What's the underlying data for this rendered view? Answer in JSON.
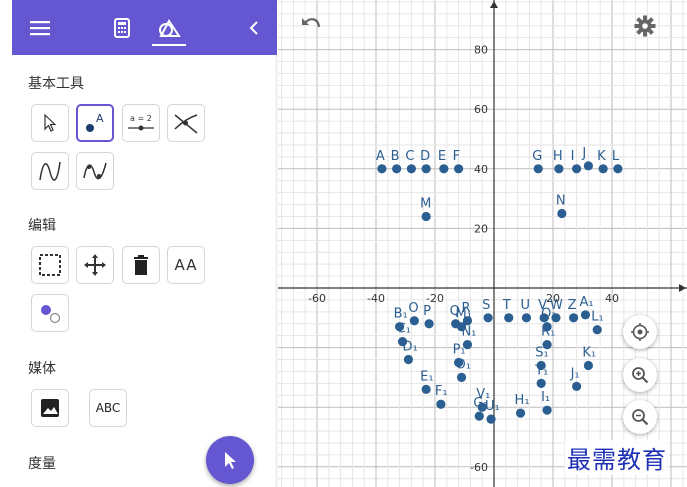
{
  "sections": {
    "basic_tools": "基本工具",
    "edit": "编辑",
    "media": "媒体",
    "measure": "度量"
  },
  "tools": {
    "slider_label": "a = 2",
    "text_tool_label": "AA",
    "text_button_label": "ABC"
  },
  "colors": {
    "accent": "#6557d2",
    "point": "#2c5f91",
    "watermark": "#1c2fb5"
  },
  "graph": {
    "x_range": [
      -70,
      70
    ],
    "y_range": [
      -65,
      95
    ],
    "x_ticks": [
      -60,
      -40,
      -20,
      20,
      40
    ],
    "y_ticks": [
      80,
      60,
      40,
      20,
      -60
    ],
    "grid": true,
    "points": [
      {
        "label": "A",
        "x": -38,
        "y": 40
      },
      {
        "label": "B",
        "x": -33,
        "y": 40
      },
      {
        "label": "C",
        "x": -28,
        "y": 40
      },
      {
        "label": "D",
        "x": -23,
        "y": 40
      },
      {
        "label": "E",
        "x": -17,
        "y": 40
      },
      {
        "label": "F",
        "x": -12,
        "y": 40
      },
      {
        "label": "G",
        "x": 15,
        "y": 40
      },
      {
        "label": "H",
        "x": 22,
        "y": 40
      },
      {
        "label": "I",
        "x": 28,
        "y": 40
      },
      {
        "label": "J",
        "x": 32,
        "y": 41
      },
      {
        "label": "K",
        "x": 37,
        "y": 40
      },
      {
        "label": "L",
        "x": 42,
        "y": 40
      },
      {
        "label": "M",
        "x": -23,
        "y": 24
      },
      {
        "label": "N",
        "x": 23,
        "y": 25
      },
      {
        "label": "O",
        "x": -27,
        "y": -11
      },
      {
        "label": "P",
        "x": -22,
        "y": -12
      },
      {
        "label": "Q",
        "x": -13,
        "y": -12
      },
      {
        "label": "R",
        "x": -9,
        "y": -11
      },
      {
        "label": "S",
        "x": -2,
        "y": -10
      },
      {
        "label": "T",
        "x": 5,
        "y": -10
      },
      {
        "label": "U",
        "x": 11,
        "y": -10
      },
      {
        "label": "V",
        "x": 17,
        "y": -10
      },
      {
        "label": "W",
        "x": 21,
        "y": -10
      },
      {
        "label": "Z",
        "x": 27,
        "y": -10
      },
      {
        "label": "A₁",
        "x": 31,
        "y": -9
      },
      {
        "label": "B₁",
        "x": -32,
        "y": -13
      },
      {
        "label": "C₁",
        "x": -31,
        "y": -18
      },
      {
        "label": "D₁",
        "x": -29,
        "y": -24
      },
      {
        "label": "E₁",
        "x": -23,
        "y": -34
      },
      {
        "label": "F₁",
        "x": -18,
        "y": -39
      },
      {
        "label": "G₁",
        "x": -5,
        "y": -43
      },
      {
        "label": "H₁",
        "x": 9,
        "y": -42
      },
      {
        "label": "I₁",
        "x": 18,
        "y": -41
      },
      {
        "label": "J₁",
        "x": 28,
        "y": -33
      },
      {
        "label": "K₁",
        "x": 32,
        "y": -26
      },
      {
        "label": "L₁",
        "x": 35,
        "y": -14
      },
      {
        "label": "M₁",
        "x": -11,
        "y": -13
      },
      {
        "label": "N₁",
        "x": -9,
        "y": -19
      },
      {
        "label": "O₁",
        "x": -11,
        "y": -30
      },
      {
        "label": "P₁",
        "x": -12,
        "y": -25
      },
      {
        "label": "Q₁",
        "x": 18,
        "y": -13
      },
      {
        "label": "R₁",
        "x": 18,
        "y": -19
      },
      {
        "label": "S₁",
        "x": 16,
        "y": -26
      },
      {
        "label": "T₁",
        "x": 16,
        "y": -32
      },
      {
        "label": "U₁",
        "x": -1,
        "y": -44
      },
      {
        "label": "V₁",
        "x": -4,
        "y": -40
      }
    ]
  },
  "watermark": "最需教育"
}
